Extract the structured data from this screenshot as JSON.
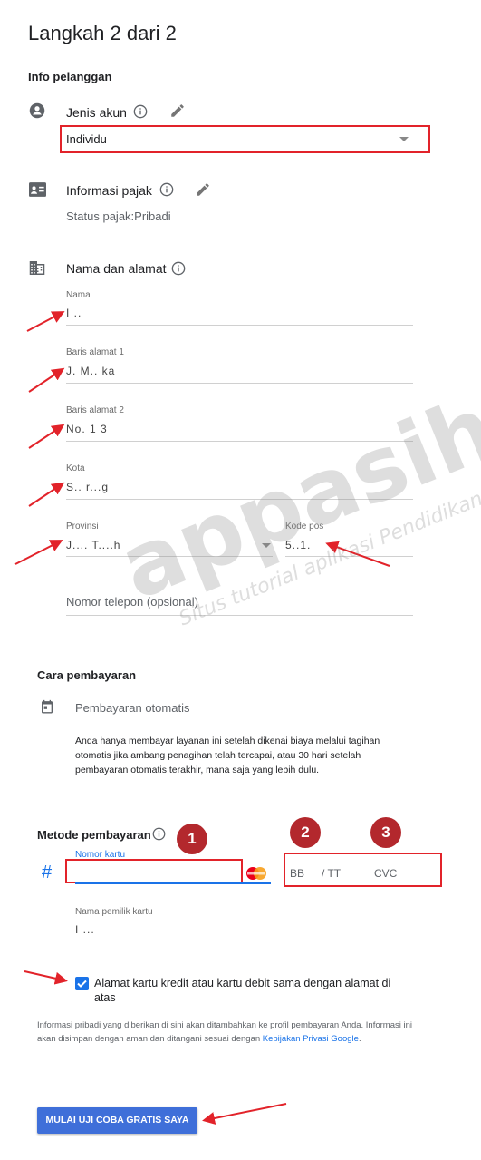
{
  "page": {
    "title": "Langkah 2 dari 2",
    "section_customer": "Info pelanggan"
  },
  "account": {
    "label": "Jenis akun",
    "selected": "Individu"
  },
  "tax": {
    "label": "Informasi pajak",
    "status_label": "Status pajak",
    "status_value": "Pribadi"
  },
  "address": {
    "label": "Nama dan alamat",
    "name_label": "Nama",
    "name_value": "I ..",
    "line1_label": "Baris alamat 1",
    "line1_value": "J. M..  ka",
    "line2_label": "Baris alamat 2",
    "line2_value": "No. 1 3",
    "city_label": "Kota",
    "city_value": "S.. r...g",
    "province_label": "Provinsi",
    "province_value": "J.... T....h",
    "postal_label": "Kode pos",
    "postal_value": "5..1.",
    "phone_placeholder": "Nomor telepon (opsional)"
  },
  "payment_way": {
    "heading": "Cara pembayaran",
    "option": "Pembayaran otomatis",
    "description": "Anda hanya membayar layanan ini setelah dikenai biaya melalui tagihan otomatis jika ambang penagihan telah tercapai, atau 30 hari setelah pembayaran otomatis terakhir, mana saja yang lebih dulu."
  },
  "payment_method": {
    "heading": "Metode pembayaran",
    "card_label": "Nomor kartu",
    "expiry_mm": "BB",
    "expiry_sep": "/ TT",
    "cvc": "CVC",
    "holder_label": "Nama pemilik kartu",
    "holder_value": "I ..."
  },
  "markers": {
    "one": "1",
    "two": "2",
    "three": "3"
  },
  "same_address": {
    "label": "Alamat kartu kredit atau kartu debit sama dengan alamat di atas"
  },
  "disclaimer": {
    "text_before": "Informasi pribadi yang diberikan di sini akan ditambahkan ke profil pembayaran Anda. Informasi ini akan disimpan dengan aman dan ditangani sesuai dengan ",
    "link": "Kebijakan Privasi Google",
    "text_after": "."
  },
  "submit": {
    "label": "MULAI UJI COBA GRATIS SAYA"
  },
  "watermark": {
    "logo": "appasih",
    "tagline": "Situs tutorial aplikasi Pendidikan.com"
  },
  "colors": {
    "accent": "#1a73e8",
    "annotation_red": "#e2232a",
    "badge": "#b3282d"
  }
}
